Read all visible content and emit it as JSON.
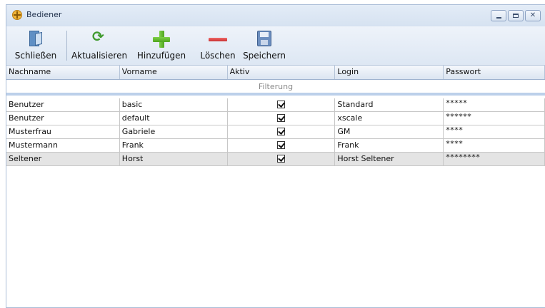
{
  "window": {
    "title": "Bediener",
    "close_glyph": "✕"
  },
  "toolbar": {
    "close_label": "Schließen",
    "refresh_label": "Aktualisieren",
    "add_label": "Hinzufügen",
    "delete_label": "Löschen",
    "save_label": "Speichern",
    "icons": [
      "door-icon",
      "refresh-icon",
      "plus-icon",
      "minus-icon",
      "save-icon"
    ]
  },
  "table": {
    "columns": [
      "Nachname",
      "Vorname",
      "Aktiv",
      "Login",
      "Passwort"
    ],
    "filter_label": "Filterung",
    "rows": [
      {
        "nachname": "Benutzer",
        "vorname": "basic",
        "aktiv": true,
        "login": "Standard",
        "passwort": "*****"
      },
      {
        "nachname": "Benutzer",
        "vorname": "default",
        "aktiv": true,
        "login": "xscale",
        "passwort": "******"
      },
      {
        "nachname": "Musterfrau",
        "vorname": "Gabriele",
        "aktiv": true,
        "login": "GM",
        "passwort": "****"
      },
      {
        "nachname": "Mustermann",
        "vorname": "Frank",
        "aktiv": true,
        "login": "Frank",
        "passwort": "****"
      },
      {
        "nachname": "Seltener",
        "vorname": "Horst",
        "aktiv": true,
        "login": "Horst Seltener",
        "passwort": "********"
      }
    ]
  },
  "colors": {
    "accent": "#dfe9f5",
    "header_border": "#9fb3cf",
    "filter_bar": "#bcd0ea"
  }
}
